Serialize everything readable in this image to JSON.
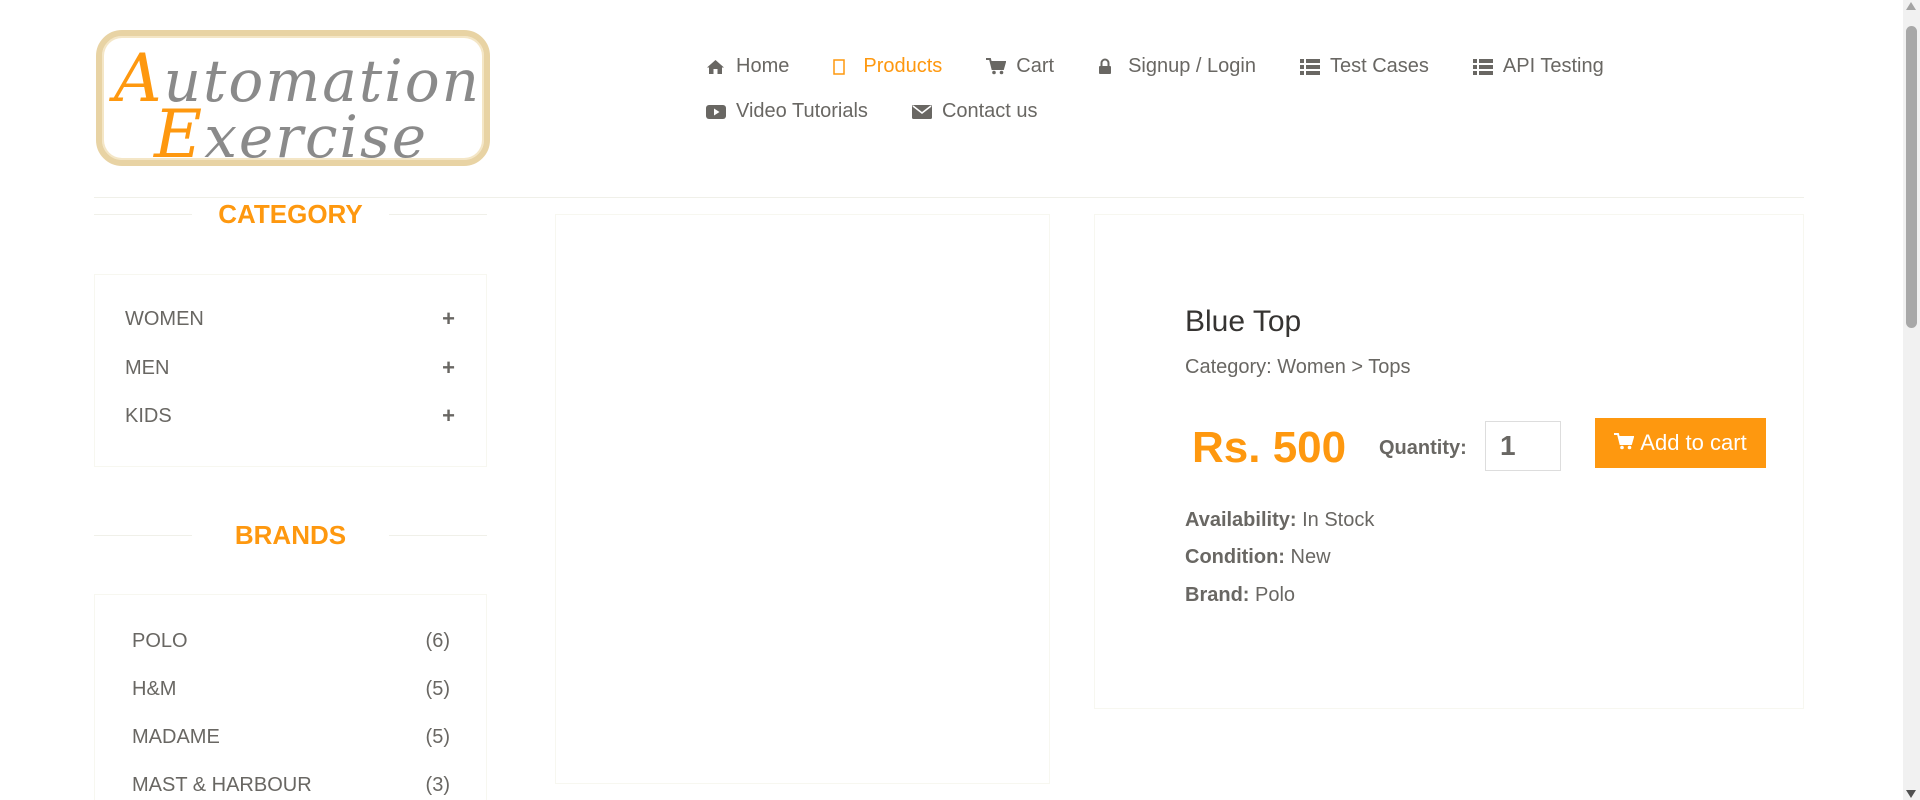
{
  "logo": {
    "line1_initial": "A",
    "line1_rest": "utomation",
    "line2_initial": "E",
    "line2_rest": "xercise"
  },
  "nav": {
    "items": [
      {
        "label": "Home",
        "icon": "home-icon"
      },
      {
        "label": "Products",
        "icon": "products-icon",
        "active": true
      },
      {
        "label": "Cart",
        "icon": "cart-icon"
      },
      {
        "label": "Signup / Login",
        "icon": "lock-icon"
      },
      {
        "label": "Test Cases",
        "icon": "list-icon"
      },
      {
        "label": "API Testing",
        "icon": "list-icon"
      },
      {
        "label": "Video Tutorials",
        "icon": "youtube-icon"
      },
      {
        "label": "Contact us",
        "icon": "envelope-icon"
      }
    ]
  },
  "sidebar": {
    "category_title": "CATEGORY",
    "categories": [
      {
        "label": "WOMEN",
        "toggle": "+"
      },
      {
        "label": "MEN",
        "toggle": "+"
      },
      {
        "label": "KIDS",
        "toggle": "+"
      }
    ],
    "brands_title": "BRANDS",
    "brands": [
      {
        "label": "POLO",
        "count": "(6)"
      },
      {
        "label": "H&M",
        "count": "(5)"
      },
      {
        "label": "MADAME",
        "count": "(5)"
      },
      {
        "label": "MAST & HARBOUR",
        "count": "(3)"
      }
    ]
  },
  "product": {
    "name": "Blue Top",
    "category": "Category: Women > Tops",
    "price": "Rs. 500",
    "quantity_label": "Quantity:",
    "quantity_value": "1",
    "add_to_cart_label": "Add to cart",
    "availability_label": "Availability:",
    "availability_value": "In Stock",
    "condition_label": "Condition:",
    "condition_value": "New",
    "brand_label": "Brand:",
    "brand_value": "Polo"
  },
  "colors": {
    "accent": "#fe980f",
    "text": "#696763"
  }
}
